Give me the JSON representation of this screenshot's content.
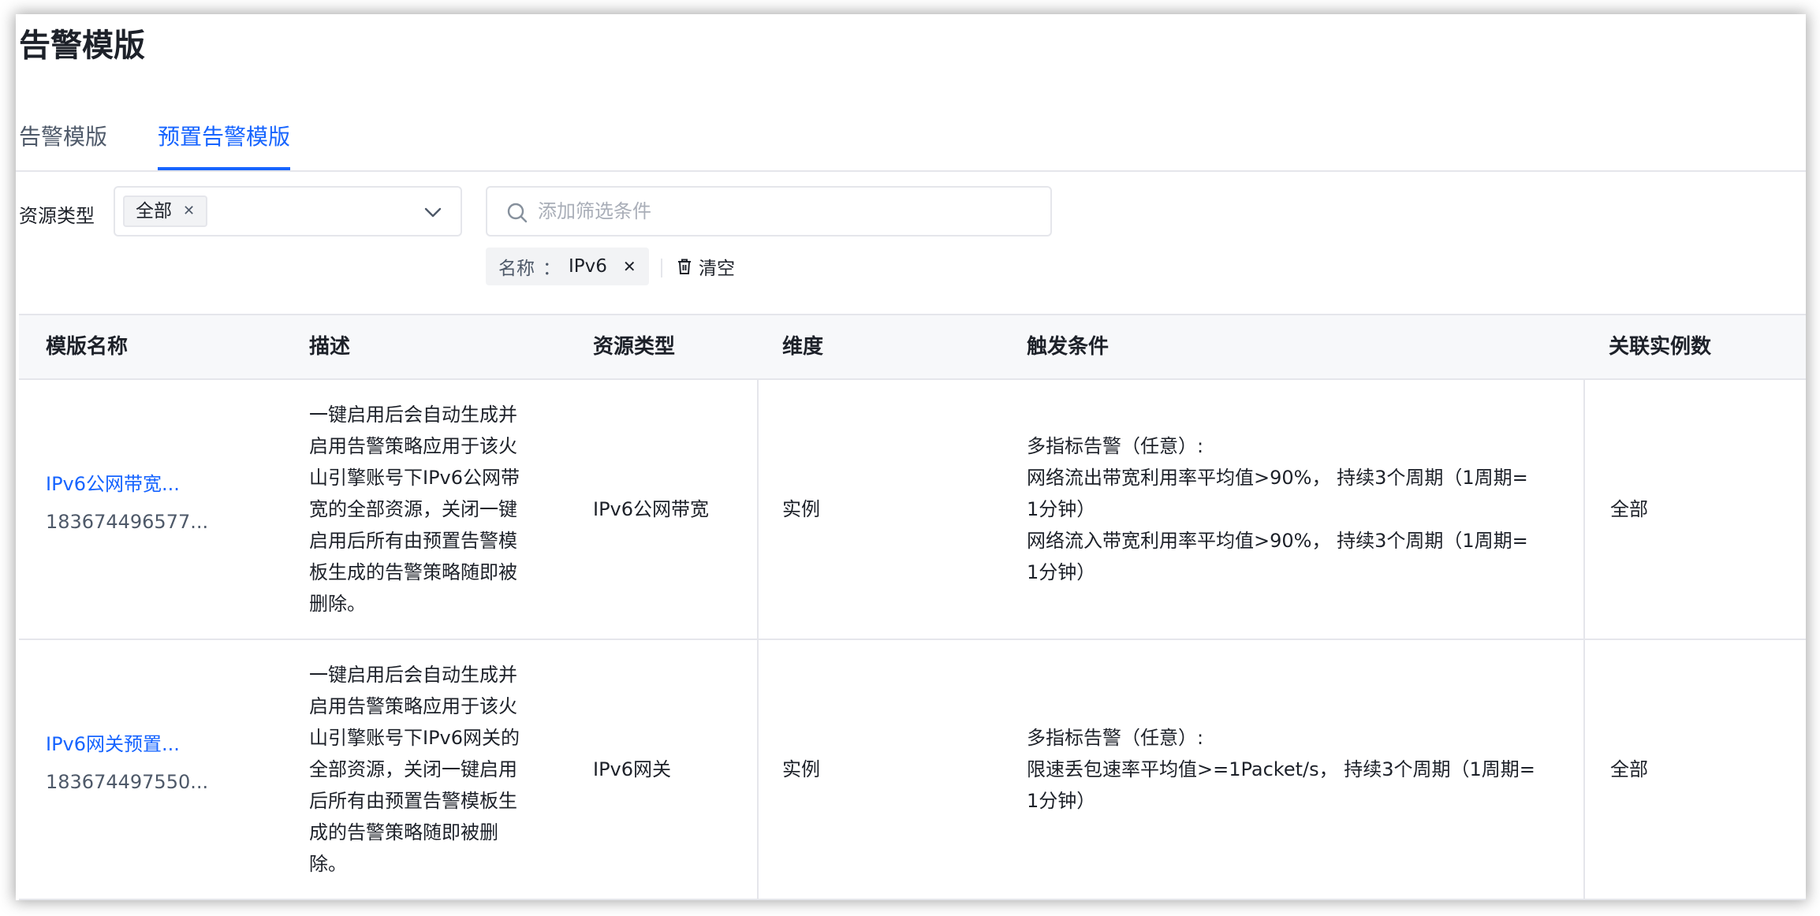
{
  "page": {
    "title": "告警模版"
  },
  "tabs": [
    {
      "label": "告警模版"
    },
    {
      "label": "预置告警模版"
    }
  ],
  "filters": {
    "resource_type_label": "资源类型",
    "resource_type_selected": "全部",
    "search_placeholder": "添加筛选条件",
    "active_chip": {
      "key": "名称",
      "sep": "：",
      "value": "IPv6"
    },
    "clear_label": "清空"
  },
  "table": {
    "headers": [
      "模版名称",
      "描述",
      "资源类型",
      "维度",
      "触发条件",
      "关联实例数"
    ],
    "rows": [
      {
        "name": "IPv6公网带宽...",
        "id": "183674496577...",
        "desc": [
          "一键启用后会自动生成并",
          "启用告警策略应用于该火",
          "山引擎账号下IPv6公网带",
          "宽的全部资源，关闭一键",
          "启用后所有由预置告警模",
          "板生成的告警策略随即被",
          "删除。"
        ],
        "resource_type": "IPv6公网带宽",
        "dimension": "实例",
        "conditions": [
          "多指标告警（任意）:",
          "网络流出带宽利用率平均值>90%，  持续3个周期（1周期=",
          "1分钟）",
          "网络流入带宽利用率平均值>90%，  持续3个周期（1周期=",
          "1分钟）"
        ],
        "instances": "全部"
      },
      {
        "name": "IPv6网关预置...",
        "id": "183674497550...",
        "desc": [
          "一键启用后会自动生成并",
          "启用告警策略应用于该火",
          "山引擎账号下IPv6网关的",
          "全部资源，关闭一键启用",
          "后所有由预置告警模板生",
          "成的告警策略随即被删",
          "除。"
        ],
        "resource_type": "IPv6网关",
        "dimension": "实例",
        "conditions": [
          "多指标告警（任意）:",
          "限速丢包速率平均值>=1Packet/s，  持续3个周期（1周期=",
          "1分钟）"
        ],
        "instances": "全部"
      }
    ]
  },
  "colors": {
    "accent": "#1664ff",
    "border": "#e5e6eb",
    "header_bg": "#f7f8fa"
  }
}
